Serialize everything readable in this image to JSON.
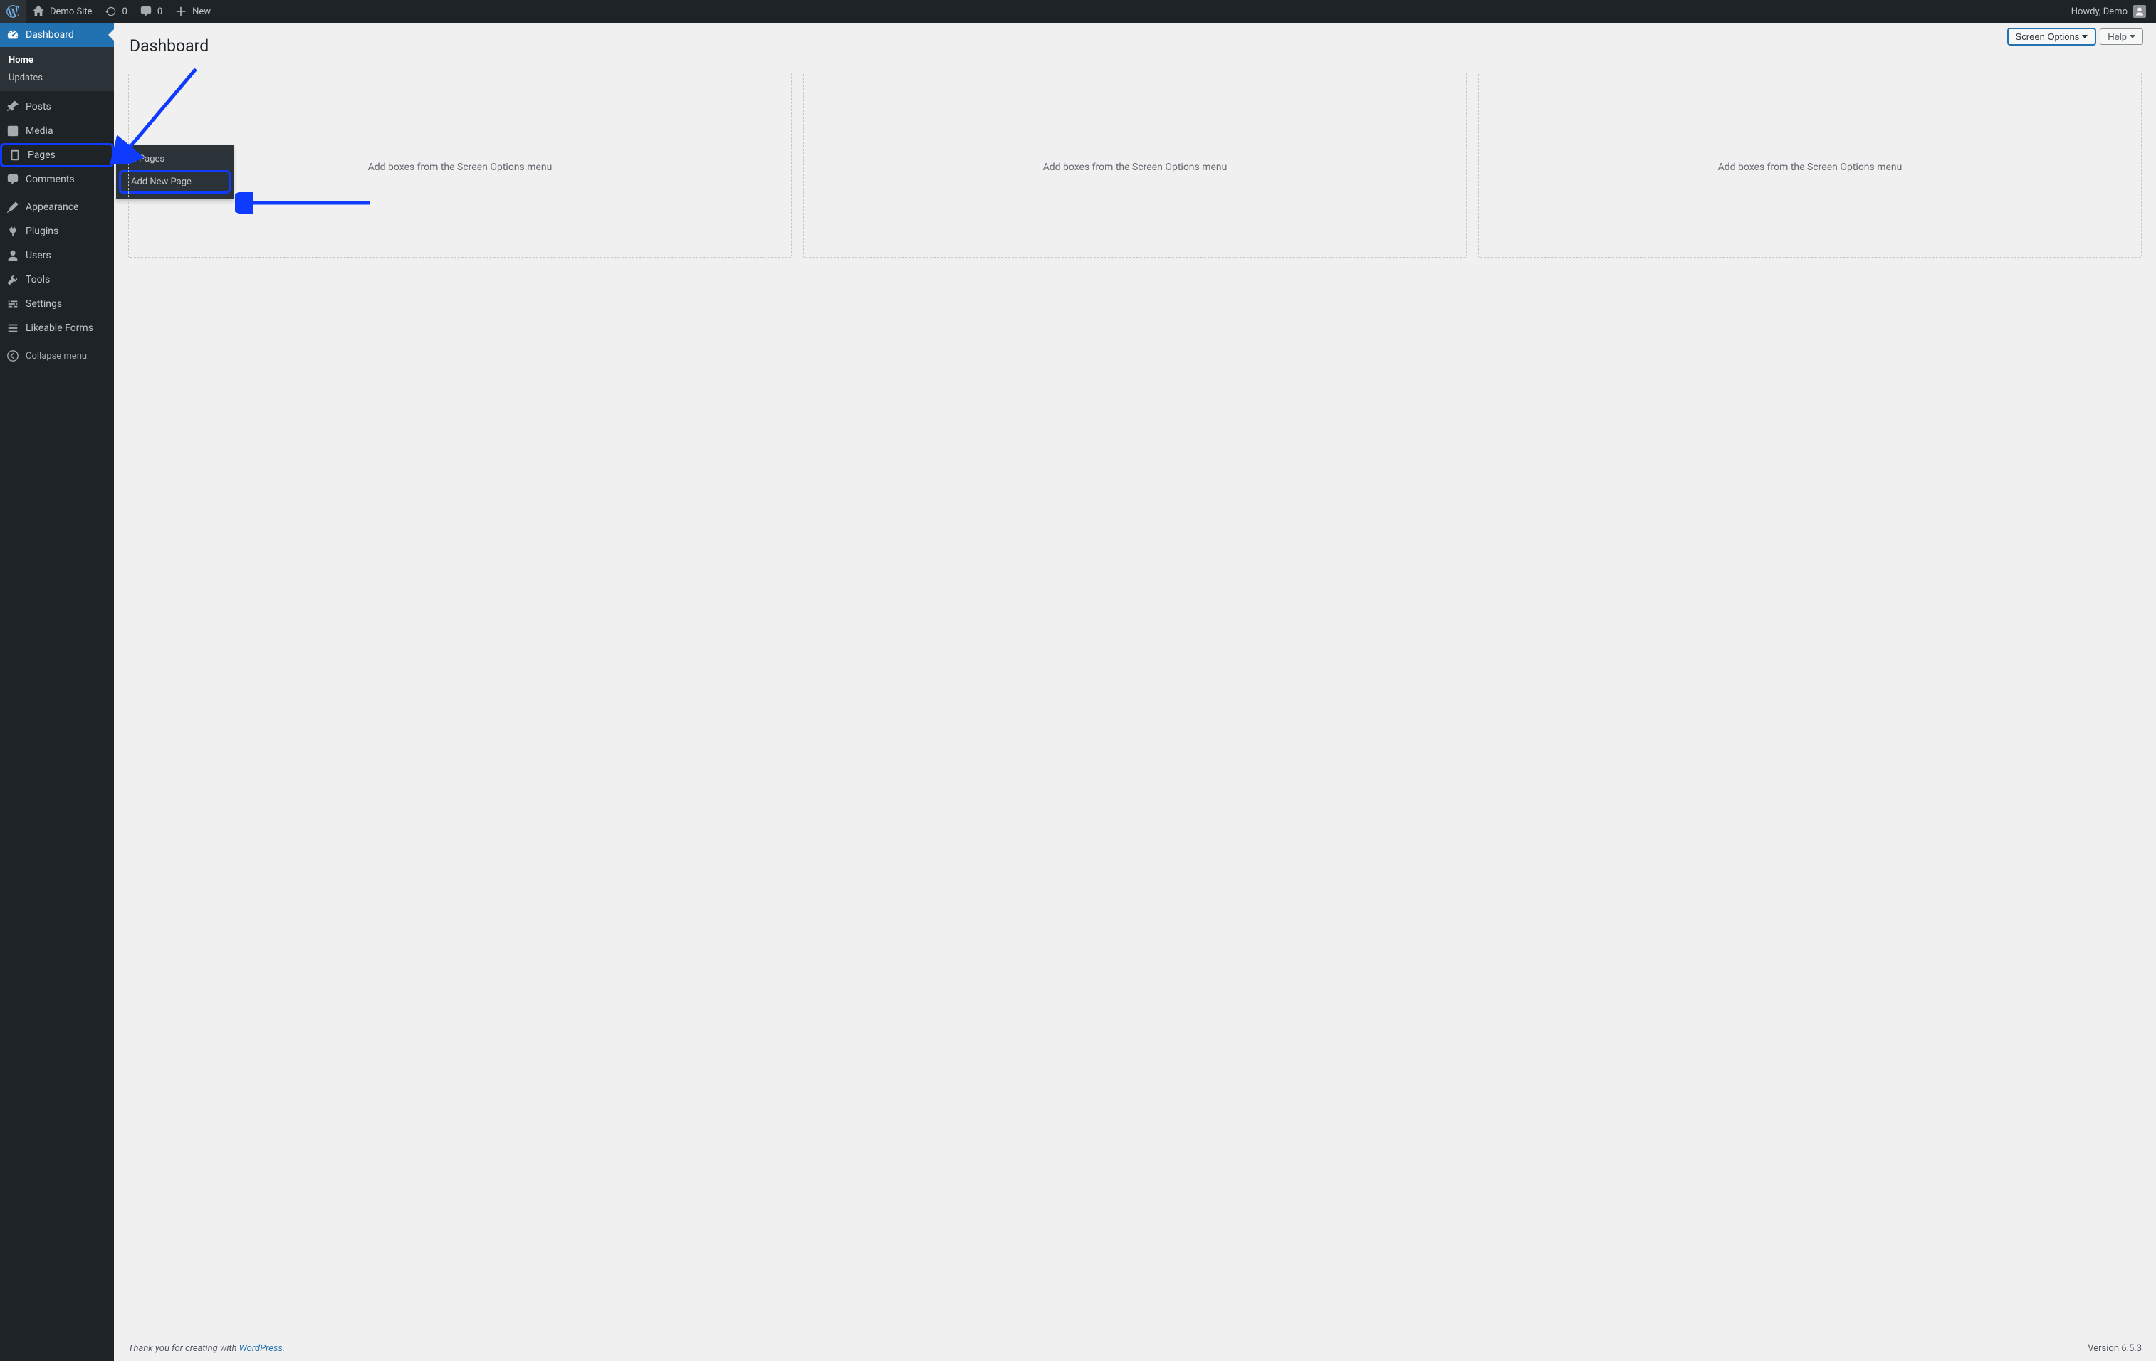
{
  "adminbar": {
    "site_name": "Demo Site",
    "updates_count": "0",
    "comments_count": "0",
    "new_label": "New",
    "howdy": "Howdy, Demo"
  },
  "sidebar": {
    "dashboard": "Dashboard",
    "sub_dashboard": {
      "home": "Home",
      "updates": "Updates"
    },
    "posts": "Posts",
    "media": "Media",
    "pages": "Pages",
    "pages_flyout": {
      "all": "All Pages",
      "add_new": "Add New Page"
    },
    "comments": "Comments",
    "appearance": "Appearance",
    "plugins": "Plugins",
    "users": "Users",
    "tools": "Tools",
    "settings": "Settings",
    "likeable_forms": "Likeable Forms",
    "collapse": "Collapse menu"
  },
  "header": {
    "page_title": "Dashboard",
    "screen_options": "Screen Options",
    "help": "Help"
  },
  "widgets": {
    "placeholder_text": "Add boxes from the Screen Options menu"
  },
  "footer": {
    "thank_prefix": "Thank you for creating with ",
    "link_text": "WordPress",
    "thank_suffix": ".",
    "version": "Version 6.5.3"
  }
}
